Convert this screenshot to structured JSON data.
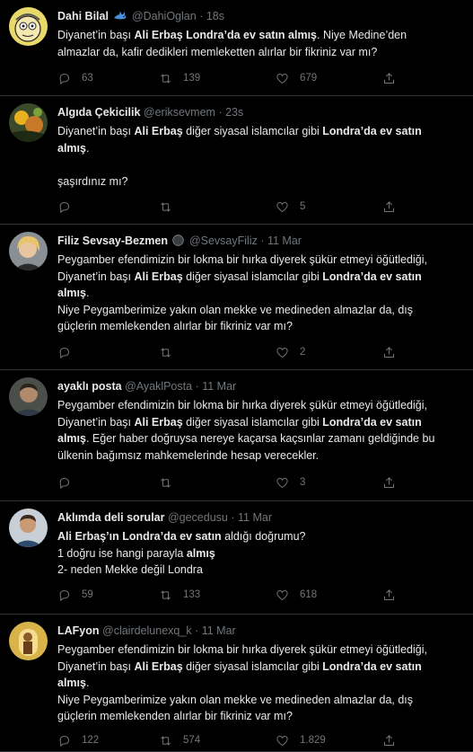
{
  "tweets": [
    {
      "name": "Dahi Bilal",
      "handle": "@DahiOglan",
      "time": "18s",
      "badge": "shark-emoji",
      "lines": [
        [
          {
            "t": "Diyanet’in başı  "
          },
          {
            "t": "Ali Erbaş Londra’da ev satın almış",
            "b": true
          },
          {
            "t": ". Niye Medine’den"
          }
        ],
        [
          {
            "t": "almazlar da, kafir dedikleri memleketten alırlar bir fikriniz var mı?"
          }
        ]
      ],
      "replies": "63",
      "retweets": "139",
      "likes": "679"
    },
    {
      "name": "Algıda Çekicilik",
      "handle": "@eriksevmem",
      "time": "23s",
      "lines": [
        [
          {
            "t": "Diyanet’in başı  "
          },
          {
            "t": "Ali Erbaş",
            "b": true
          },
          {
            "t": " diğer siyasal islamcılar gibi "
          },
          {
            "t": "Londra’da ev satın",
            "b": true
          }
        ],
        [
          {
            "t": "almış",
            "b": true
          },
          {
            "t": "."
          }
        ],
        [],
        [
          {
            "t": "şaşırdınız mı?"
          }
        ]
      ],
      "replies": "",
      "retweets": "",
      "likes": "5"
    },
    {
      "name": "Filiz Sevsay-Bezmen",
      "handle": "@SevsayFiliz",
      "time": "11 Mar",
      "badge": "black-circle",
      "lines": [
        [
          {
            "t": "Peygamber efendimizin bir lokma bir hırka diyerek şükür etmeyi öğütlediği,"
          }
        ],
        [
          {
            "t": "Diyanet’in başı  "
          },
          {
            "t": "Ali Erbaş",
            "b": true
          },
          {
            "t": " diğer siyasal islamcılar gibi "
          },
          {
            "t": "Londra’da ev satın",
            "b": true
          }
        ],
        [
          {
            "t": "almış",
            "b": true
          },
          {
            "t": "."
          }
        ],
        [
          {
            "t": "Niye Peygamberimize yakın olan mekke ve medineden almazlar da, dış"
          }
        ],
        [
          {
            "t": "güçlerin memlekenden alırlar bir fikriniz var mı?"
          }
        ]
      ],
      "replies": "",
      "retweets": "",
      "likes": "2"
    },
    {
      "name": "ayaklı posta",
      "handle": "@AyaklPosta",
      "time": "11 Mar",
      "lines": [
        [
          {
            "t": "Peygamber efendimizin bir lokma bir hırka diyerek şükür etmeyi öğütlediği,"
          }
        ],
        [
          {
            "t": "Diyanet’in başı  "
          },
          {
            "t": "Ali Erbaş",
            "b": true
          },
          {
            "t": " diğer siyasal islamcılar gibi "
          },
          {
            "t": "Londra’da ev satın",
            "b": true
          }
        ],
        [
          {
            "t": "almış",
            "b": true
          },
          {
            "t": ". Eğer haber doğruysa nereye kaçarsa kaçsınlar zamanı geldiğinde bu"
          }
        ],
        [
          {
            "t": "ülkenin bağımsız mahkemelerinde hesap verecekler."
          }
        ]
      ],
      "replies": "",
      "retweets": "",
      "likes": "3"
    },
    {
      "name": "Aklımda deli sorular",
      "handle": "@gecedusu",
      "time": "11 Mar",
      "lines": [
        [
          {
            "t": "Ali Erbaş’ın Londra’da ev satın",
            "b": true
          },
          {
            "t": " aldığı doğrumu?"
          }
        ],
        [
          {
            "t": "1 doğru ise hangi parayla "
          },
          {
            "t": "almış",
            "b": true
          }
        ],
        [
          {
            "t": "2- neden Mekke değil Londra"
          }
        ]
      ],
      "replies": "59",
      "retweets": "133",
      "likes": "618"
    },
    {
      "name": "LAFyon",
      "handle": "@clairdelunexq_k",
      "time": "11 Mar",
      "lines": [
        [
          {
            "t": "Peygamber efendimizin bir lokma bir hırka diyerek şükür etmeyi öğütlediği,"
          }
        ],
        [
          {
            "t": "Diyanet’in başı  "
          },
          {
            "t": "Ali Erbaş",
            "b": true
          },
          {
            "t": " diğer siyasal islamcılar gibi "
          },
          {
            "t": "Londra’da ev satın",
            "b": true
          }
        ],
        [
          {
            "t": "almış",
            "b": true
          },
          {
            "t": "."
          }
        ],
        [
          {
            "t": "Niye Peygamberimize yakın olan mekke ve medineden almazlar da, dış"
          }
        ],
        [
          {
            "t": "güçlerin memlekenden alırlar bir fikriniz var mı?"
          }
        ]
      ],
      "replies": "122",
      "retweets": "574",
      "likes": "1.829"
    }
  ],
  "separator": "·",
  "colors": {
    "background": "#000000",
    "text": "#e7e9ea",
    "muted": "#71767b",
    "border": "#2f3336",
    "shark": "#4a90d9"
  },
  "icons": {
    "reply": "reply-icon",
    "retweet": "retweet-icon",
    "like": "like-icon",
    "share": "share-icon"
  }
}
